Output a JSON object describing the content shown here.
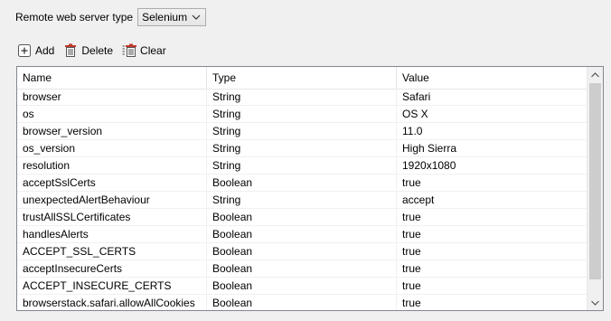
{
  "server": {
    "label": "Remote web server type",
    "selected": "Selenium"
  },
  "toolbar": {
    "add": "Add",
    "delete": "Delete",
    "clear": "Clear"
  },
  "table": {
    "columns": [
      "Name",
      "Type",
      "Value"
    ],
    "rows": [
      [
        "browser",
        "String",
        "Safari"
      ],
      [
        "os",
        "String",
        "OS X"
      ],
      [
        "browser_version",
        "String",
        "11.0"
      ],
      [
        "os_version",
        "String",
        "High Sierra"
      ],
      [
        "resolution",
        "String",
        "1920x1080"
      ],
      [
        "acceptSslCerts",
        "Boolean",
        "true"
      ],
      [
        "unexpectedAlertBehaviour",
        "String",
        "accept"
      ],
      [
        "trustAllSSLCertificates",
        "Boolean",
        "true"
      ],
      [
        "handlesAlerts",
        "Boolean",
        "true"
      ],
      [
        "ACCEPT_SSL_CERTS",
        "Boolean",
        "true"
      ],
      [
        "acceptInsecureCerts",
        "Boolean",
        "true"
      ],
      [
        "ACCEPT_INSECURE_CERTS",
        "Boolean",
        "true"
      ],
      [
        "browserstack.safari.allowAllCookies",
        "Boolean",
        "true"
      ]
    ]
  }
}
